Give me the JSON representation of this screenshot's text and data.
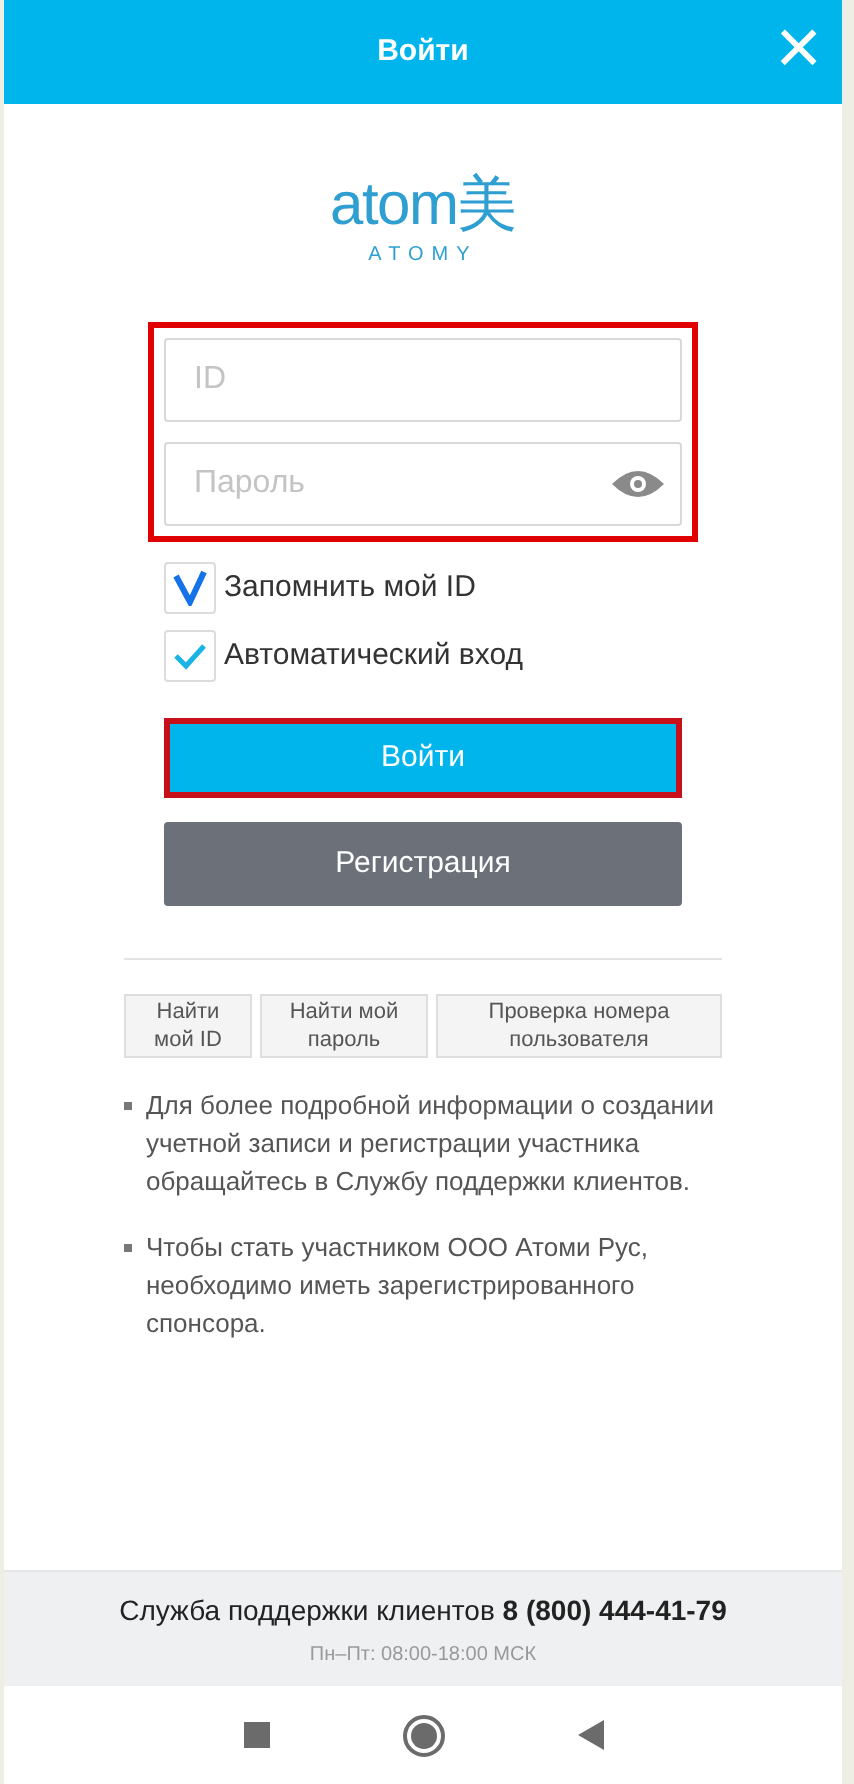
{
  "header": {
    "title": "Войти",
    "close": "×"
  },
  "logo": {
    "wordmark": "atom美",
    "subtitle": "ATOMY"
  },
  "credentials": {
    "highlighted": true,
    "fields": [
      {
        "placeholder": "ID",
        "kind": "text"
      },
      {
        "placeholder": "Пароль",
        "kind": "password"
      }
    ]
  },
  "options": [
    {
      "label": "Запомнить мой ID",
      "checked": true,
      "kind": "bold"
    },
    {
      "label": "Автоматический вход",
      "checked": true,
      "kind": "light"
    }
  ],
  "login_button": {
    "label": "Войти",
    "highlighted": true
  },
  "register_button": {
    "label": "Регистрация"
  },
  "links": [
    {
      "label": "Найти\nмой ID"
    },
    {
      "label": "Найти мой\nпароль"
    },
    {
      "label": "Проверка номера\nпользователя"
    }
  ],
  "notes": [
    "Для более подробной информации о создании учетной записи и регистрации участника обращайтесь в Службу поддержки клиентов.",
    "Чтобы стать участником ООО Атоми Рус, необходимо иметь зарегистрированного спонсора."
  ],
  "support": {
    "text": "Служба поддержки клиентов **8 (800) 444-41-79**",
    "hours": "Пн–Пт: 08:00-18:00 МСК"
  }
}
